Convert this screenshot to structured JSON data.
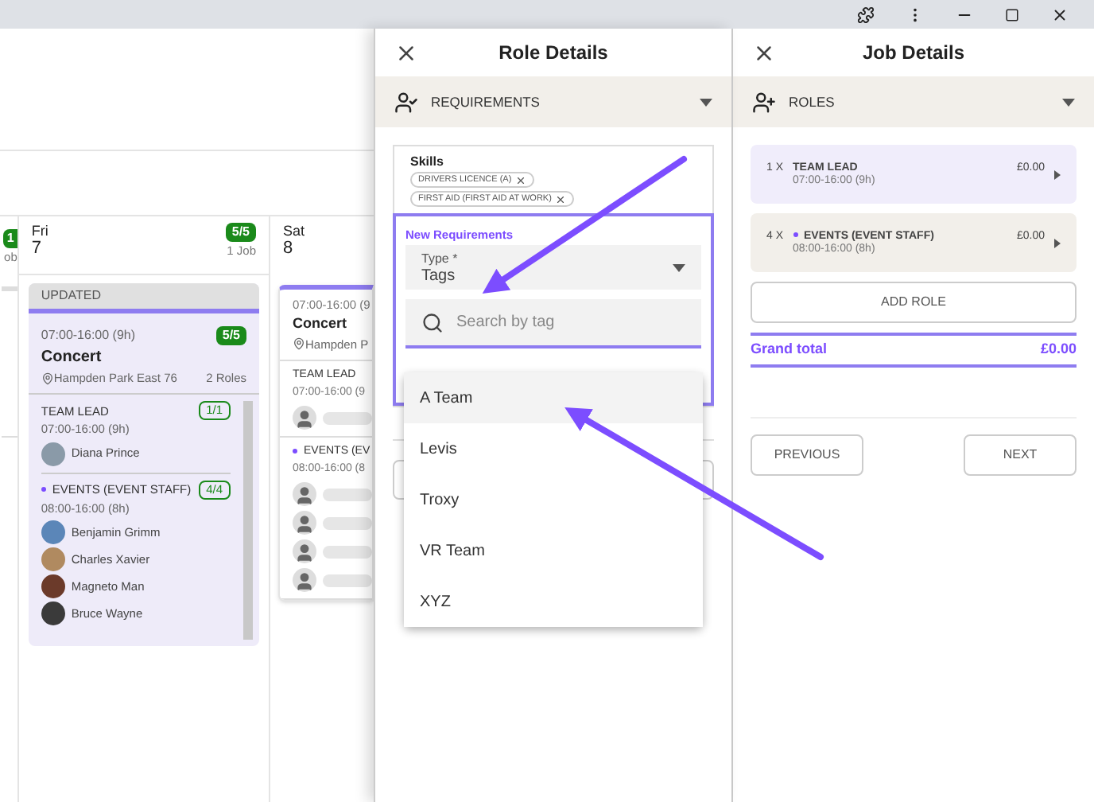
{
  "calendar": {
    "partial_column": {
      "badge": "1",
      "jobs": "ob"
    },
    "days": [
      {
        "name": "Fri",
        "date": "7",
        "badge": "5/5",
        "jobs": "1 Job",
        "card": {
          "status": "UPDATED",
          "time": "07:00-16:00 (9h)",
          "badge": "5/5",
          "title": "Concert",
          "location": "Hampden Park East 76",
          "roles_count": "2 Roles",
          "roles": [
            {
              "name": "TEAM LEAD",
              "marked": false,
              "badge": "1/1",
              "time": "07:00-16:00 (9h)",
              "people": [
                {
                  "name": "Diana Prince",
                  "color": "#8a9aa8"
                }
              ]
            },
            {
              "name": "EVENTS (EVENT STAFF)",
              "marked": true,
              "badge": "4/4",
              "time": "08:00-16:00 (8h)",
              "people": [
                {
                  "name": "Benjamin Grimm",
                  "color": "#5b86b8"
                },
                {
                  "name": "Charles Xavier",
                  "color": "#b08a60"
                },
                {
                  "name": "Magneto Man",
                  "color": "#6b3a2a"
                },
                {
                  "name": "Bruce Wayne",
                  "color": "#3a3a3a"
                }
              ]
            }
          ]
        }
      },
      {
        "name": "Sat",
        "date": "8",
        "card": {
          "time": "07:00-16:00 (9",
          "title": "Concert",
          "location": "Hampden P",
          "roles": [
            {
              "name": "TEAM LEAD",
              "marked": false,
              "time": "07:00-16:00 (9",
              "slots": [
                {
                  "filled": false
                }
              ]
            },
            {
              "name": "EVENTS (EV",
              "marked": true,
              "time": "08:00-16:00 (8",
              "slots": [
                {
                  "filled": false
                },
                {
                  "filled": false
                },
                {
                  "filled": false
                },
                {
                  "filled": false
                }
              ]
            }
          ]
        }
      }
    ]
  },
  "role_details": {
    "title": "Role Details",
    "section": "REQUIREMENTS",
    "skills_label": "Skills",
    "skills": [
      "DRIVERS LICENCE (A)",
      "FIRST AID (FIRST AID AT WORK)"
    ],
    "new_requirements": {
      "title": "New Requirements",
      "type_label": "Type *",
      "type_value": "Tags",
      "search_placeholder": "Search by tag"
    },
    "options": [
      {
        "label": "A Team",
        "selected": true
      },
      {
        "label": "Levis",
        "selected": false
      },
      {
        "label": "Troxy",
        "selected": false
      },
      {
        "label": "VR Team",
        "selected": false
      },
      {
        "label": "XYZ",
        "selected": false
      }
    ]
  },
  "job_details": {
    "title": "Job Details",
    "section": "ROLES",
    "roles": [
      {
        "qty": "1 X",
        "name": "TEAM LEAD",
        "marked": false,
        "time": "07:00-16:00 (9h)",
        "price": "£0.00",
        "color": "#f0edfb"
      },
      {
        "qty": "4 X",
        "name": "EVENTS (EVENT STAFF)",
        "marked": true,
        "time": "08:00-16:00 (8h)",
        "price": "£0.00",
        "color": "#f2efea"
      }
    ],
    "add_button": "ADD ROLE",
    "total_label": "Grand total",
    "total_value": "£0.00",
    "buttons": [
      "PREVIOUS",
      "NEXT"
    ]
  }
}
